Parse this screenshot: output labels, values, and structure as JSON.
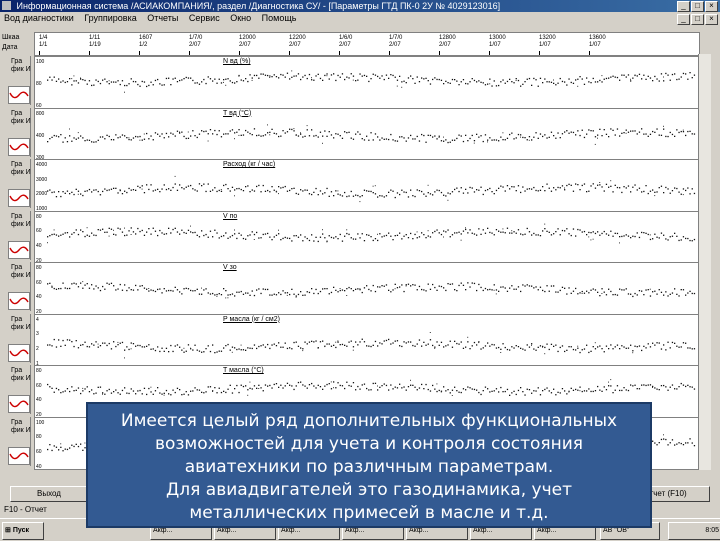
{
  "window": {
    "title": "Информационная система /АСИАКОМПАНИЯ/, раздел /Диагностика СУ/ - [Параметры ГТД ПК-0 2У № 4029123016]",
    "controls": [
      "_",
      "□",
      "×"
    ]
  },
  "menu": [
    "Вод диагностики",
    "Группировка",
    "Отчеты",
    "Сервис",
    "Окно",
    "Помощь"
  ],
  "header_labels": [
    "Шкаа",
    "Дата"
  ],
  "timeline_ticks": [
    {
      "top": "1/4",
      "bottom": "1/1"
    },
    {
      "top": "1/11",
      "bottom": "1/19"
    },
    {
      "top": "1607",
      "bottom": "1/2"
    },
    {
      "top": "1/7/0",
      "bottom": "2/07"
    },
    {
      "top": "12000",
      "bottom": "2/07"
    },
    {
      "top": "12200",
      "bottom": "2/07"
    },
    {
      "top": "1/6/0",
      "bottom": "2/07"
    },
    {
      "top": "1/7/0",
      "bottom": "2/07"
    },
    {
      "top": "12800",
      "bottom": "2/07"
    },
    {
      "top": "13000",
      "bottom": "1/07"
    },
    {
      "top": "13200",
      "bottom": "1/07"
    },
    {
      "top": "13600",
      "bottom": "1/07"
    }
  ],
  "side_label": "Гра фик И",
  "panels": [
    {
      "title": "N вд (%)",
      "scales": [
        "100",
        "80",
        "60"
      ]
    },
    {
      "title": "T вд (°C)",
      "scales": [
        "800",
        "400",
        "300"
      ]
    },
    {
      "title": "Расход (кг / час)",
      "scales": [
        "4000",
        "3000",
        "2000",
        "1000"
      ]
    },
    {
      "title": "V по",
      "scales": [
        "80",
        "60",
        "40",
        "20"
      ]
    },
    {
      "title": "V зо",
      "scales": [
        "80",
        "60",
        "40",
        "20"
      ]
    },
    {
      "title": "P масла (кг / см2)",
      "scales": [
        "4",
        "3",
        "2",
        "1"
      ]
    },
    {
      "title": "T масла (°C)",
      "scales": [
        "80",
        "60",
        "40",
        "20"
      ]
    },
    {
      "title": "",
      "scales": [
        "100",
        "80",
        "60",
        "40"
      ]
    }
  ],
  "status_buttons": [
    "Выход",
    "Отчет (F10)"
  ],
  "bottom_status": "F10 - Отчет",
  "taskbar": {
    "start": "Пуск",
    "items": [
      "Акф...",
      "Акф...",
      "Акф...",
      "Акф...",
      "Акф...",
      "Акф...",
      "Акф..."
    ],
    "tray": "АВ \"ОВ\"",
    "clock": "8:05"
  },
  "overlay_lines": [
    "Имеется целый ряд дополнительных функциональных",
    "возможностей для учета и контроля состояния",
    "авиатехники по различным параметрам.",
    "Для авиадвигателей это газодинамика, учет",
    "металлических примесей в масле и т.д."
  ]
}
